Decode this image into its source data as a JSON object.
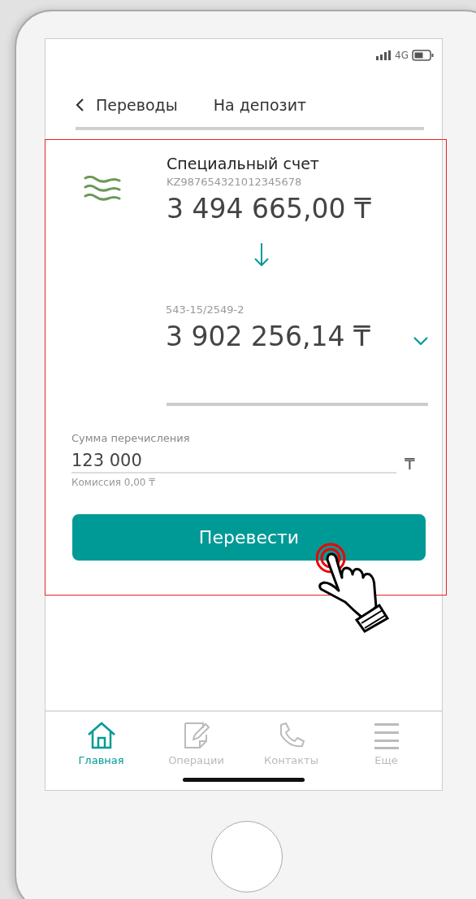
{
  "status_bar": {
    "network": "4G"
  },
  "header": {
    "back_label": "Переводы",
    "title": "На депозит"
  },
  "from_account": {
    "name": "Специальный счет",
    "number": "KZ987654321012345678",
    "amount": "3 494 665,00",
    "currency": "₸"
  },
  "to_account": {
    "number": "543-15/2549-2",
    "amount": "3 902 256,14",
    "currency": "₸"
  },
  "amount_field": {
    "label": "Сумма перечисления",
    "value": "123 000",
    "currency": "₸",
    "commission": "Комиссия 0,00 ₸"
  },
  "submit_button": "Перевести",
  "bottom_nav": [
    {
      "kind": "home",
      "label": "Главная",
      "selected": true
    },
    {
      "kind": "operations",
      "label": "Операции",
      "selected": false
    },
    {
      "kind": "contacts",
      "label": "Контакты",
      "selected": false
    },
    {
      "kind": "more",
      "label": "Еще",
      "selected": false
    }
  ]
}
